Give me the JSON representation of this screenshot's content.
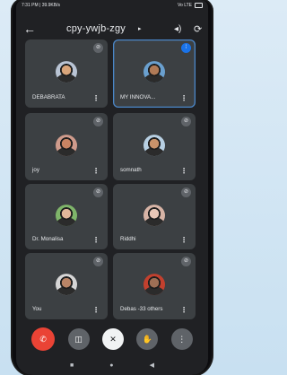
{
  "status": {
    "time": "7:31 PM | 39.9KB/s",
    "right": "Vo LTE"
  },
  "meeting": {
    "code": "cpy-ywjb-zgy",
    "caret": "▸"
  },
  "icons": {
    "back": "arrow-left-icon",
    "speaker": "speaker-icon",
    "rotate": "switch-camera-icon",
    "muted": "mic-off-icon",
    "more": "more-vert-icon"
  },
  "participants": [
    {
      "name": "DEBABRATA",
      "muted": true,
      "active": false,
      "skin": "#d9a57a",
      "bg": "#b9c4d4"
    },
    {
      "name": "MY INNOVA...",
      "muted": false,
      "active": true,
      "skin": "#b07a56",
      "bg": "#6aa0cf"
    },
    {
      "name": "joy",
      "muted": true,
      "active": false,
      "skin": "#c98362",
      "bg": "#cf9b8c"
    },
    {
      "name": "somnath",
      "muted": true,
      "active": false,
      "skin": "#c8926a",
      "bg": "#b8d0e3"
    },
    {
      "name": "Dr. Monalisa",
      "muted": true,
      "active": false,
      "skin": "#e2b79a",
      "bg": "#7fb56a"
    },
    {
      "name": "Riddhi",
      "muted": true,
      "active": false,
      "skin": "#e8c6b6",
      "bg": "#d7b4a6"
    },
    {
      "name": "You",
      "muted": true,
      "active": false,
      "skin": "#b98466",
      "bg": "#d6d6d6"
    },
    {
      "name": "Debas  -33 others",
      "muted": true,
      "active": false,
      "skin": "#9e6f55",
      "bg": "#c2402e"
    }
  ],
  "controls": {
    "end_call": "✆",
    "camera_off": "◫",
    "mic_off": "✕",
    "raise_hand": "✋",
    "more": "⋮"
  },
  "nav": {
    "recents": "■",
    "home": "●",
    "back": "◀"
  },
  "colors": {
    "tile_bg": "#3c4043",
    "accent": "#1a73e8",
    "end": "#ea4335"
  }
}
